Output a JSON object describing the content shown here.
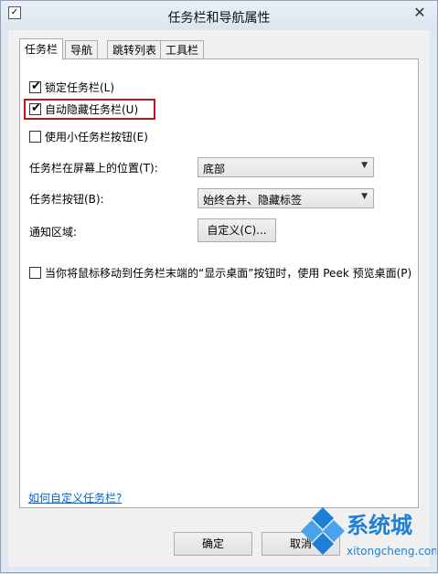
{
  "window": {
    "title": "任务栏和导航属性",
    "app_icon": "taskbar-properties-icon",
    "close_label": "✕"
  },
  "tabs": [
    {
      "label": "任务栏",
      "active": true
    },
    {
      "label": "导航",
      "active": false
    },
    {
      "label": "跳转列表",
      "active": false
    },
    {
      "label": "工具栏",
      "active": false
    }
  ],
  "taskbar": {
    "lock_label": "锁定任务栏(L)",
    "lock_checked": true,
    "autohide_label": "自动隐藏任务栏(U)",
    "autohide_checked": true,
    "small_buttons_label": "使用小任务栏按钮(E)",
    "small_buttons_checked": false,
    "location_label": "任务栏在屏幕上的位置(T):",
    "location_value": "底部",
    "buttons_label": "任务栏按钮(B):",
    "buttons_value": "始终合并、隐藏标签",
    "notification_label": "通知区域:",
    "customize_button": "自定义(C)...",
    "peek_label": "当你将鼠标移动到任务栏末端的“显示桌面”按钮时，使用 Peek 预览桌面(P)",
    "peek_checked": false
  },
  "help_link": "如何自定义任务栏?",
  "buttons": {
    "ok": "确定",
    "cancel": "取消"
  },
  "watermark": {
    "brand": "系统城",
    "url": "xitongcheng.com"
  },
  "colors": {
    "highlight": "#b11c1c",
    "link": "#0066cc",
    "watermark_blue": "#1e7fd6"
  }
}
